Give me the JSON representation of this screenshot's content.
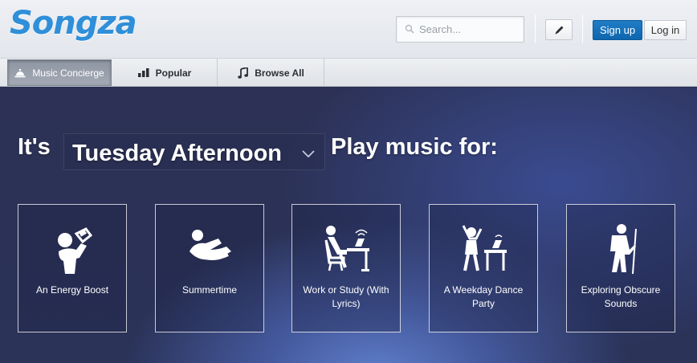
{
  "header": {
    "logo_text": "Songza",
    "search": {
      "placeholder": "Search..."
    },
    "sign_up_label": "Sign up",
    "log_in_label": "Log in"
  },
  "nav": {
    "tabs": [
      {
        "label": "Music Concierge",
        "icon": "concierge-bell-icon",
        "active": true
      },
      {
        "label": "Popular",
        "icon": "bar-chart-icon",
        "active": false
      },
      {
        "label": "Browse All",
        "icon": "music-note-icon",
        "active": false
      }
    ]
  },
  "main": {
    "prefix": "It's",
    "selected_time": "Tuesday Afternoon",
    "suffix": "Play music for:",
    "cards": [
      {
        "label": "An Energy Boost",
        "icon": "drinking-figure-icon"
      },
      {
        "label": "Summertime",
        "icon": "sunbathing-figure-icon"
      },
      {
        "label": "Work or Study (With Lyrics)",
        "icon": "desk-worker-icon"
      },
      {
        "label": "A Weekday Dance Party",
        "icon": "office-dancer-icon"
      },
      {
        "label": "Exploring Obscure Sounds",
        "icon": "hiker-icon"
      }
    ]
  },
  "colors": {
    "brand": "#2f8fd8",
    "signup": "#1470b8"
  }
}
